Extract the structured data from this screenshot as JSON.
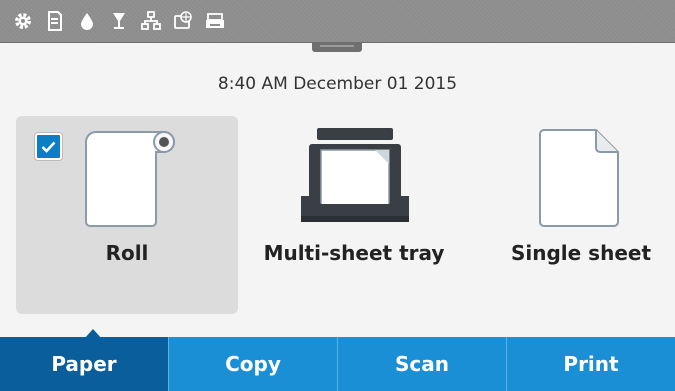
{
  "status_bar": {
    "icons": [
      "settings-icon",
      "printhead-icon",
      "ink-drop-icon",
      "cup-icon",
      "network-icon",
      "web-services-icon",
      "printer-status-icon"
    ]
  },
  "datetime": "8:40 AM December 01 2015",
  "sources": [
    {
      "label": "Roll",
      "icon": "roll-icon",
      "selected": true
    },
    {
      "label": "Multi-sheet tray",
      "icon": "multi-sheet-tray-icon",
      "selected": false
    },
    {
      "label": "Single sheet",
      "icon": "single-sheet-icon",
      "selected": false
    }
  ],
  "tabs": [
    {
      "label": "Paper",
      "active": true
    },
    {
      "label": "Copy",
      "active": false
    },
    {
      "label": "Scan",
      "active": false
    },
    {
      "label": "Print",
      "active": false
    }
  ],
  "colors": {
    "accent": "#1b8fd6",
    "accent_active": "#0a5e9c",
    "checkbox": "#0c7ec4",
    "status_bar": "#8d8d8d"
  }
}
